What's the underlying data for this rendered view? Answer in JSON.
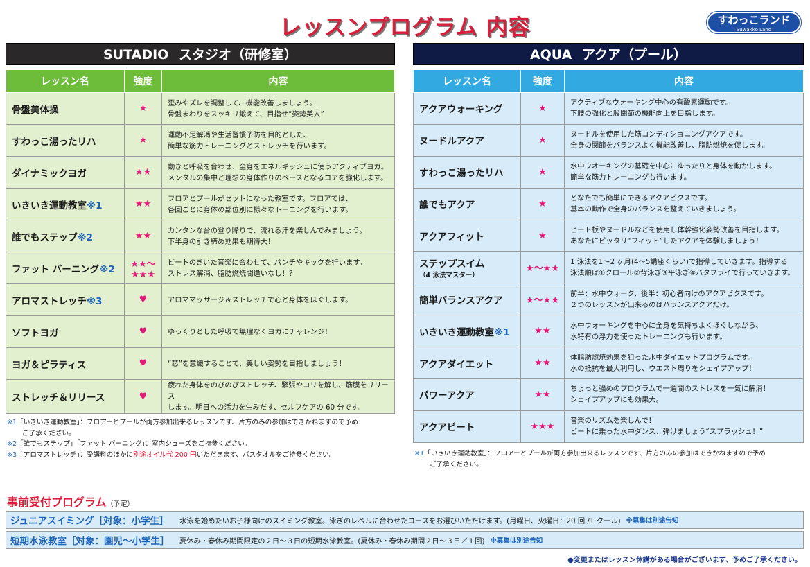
{
  "title": "レッスンプログラム 内容",
  "logo": {
    "main": "すわっこランド",
    "sub": "Suwakko Land"
  },
  "studio": {
    "heading_en": "SUTADIO",
    "heading_ja": "スタジオ（研修室）",
    "columns": [
      "レッスン名",
      "強度",
      "内容"
    ],
    "rows": [
      {
        "name": "骨盤美体操",
        "mark": "",
        "level": "★",
        "desc1": "歪みやズレを調整して、機能改善しましょう。",
        "desc2": "骨盤まわりをスッキリ鍛えて、目指せ“姿勢美人”"
      },
      {
        "name": "すわっこ湯ったリハ",
        "mark": "",
        "level": "★",
        "desc1": "運動不足解消や生活習慣予防を目的とした、",
        "desc2": "簡単な筋力トレーニングとストレッチを行います。"
      },
      {
        "name": "ダイナミックヨガ",
        "mark": "",
        "level": "★★",
        "desc1": "動きと呼吸を合わせ、全身をエネルギッシュに使うアクティブヨガ。",
        "desc2": "メンタルの集中と理想の身体作りのベースとなるコアを強化します。"
      },
      {
        "name": "いきいき運動教室",
        "mark": "※1",
        "level": "★★",
        "desc1": "フロアとプールがセットになった教室です。フロアでは、",
        "desc2": "各回ごとに身体の部位別に様々なトーニングを行います。"
      },
      {
        "name": "誰でもステップ",
        "mark": "※2",
        "level": "★★",
        "desc1": "カンタンな台の登り降りで、流れる汗を楽しんでみましょう。",
        "desc2": "下半身の引き締め効果も期待大！"
      },
      {
        "name": "ファット バーニング",
        "mark": "※2",
        "level": "★★～★★★",
        "desc1": "ビートのきいた音楽に合わせて、パンチやキックを行います。",
        "desc2": "ストレス解消、脂肪燃焼間違いなし！？"
      },
      {
        "name": "アロマストレッチ",
        "mark": "※3",
        "level": "♥",
        "desc1": "アロママッサージ＆ストレッチで心と身体をほぐします。",
        "desc2": ""
      },
      {
        "name": "ソフトヨガ",
        "mark": "",
        "level": "♥",
        "desc1": "ゆっくりとした呼吸で無理なくヨガにチャレンジ！",
        "desc2": ""
      },
      {
        "name": "ヨガ＆ピラティス",
        "mark": "",
        "level": "♥",
        "desc1": "“芯”を意識することで、美しい姿勢を目指しましょう！",
        "desc2": ""
      },
      {
        "name": "ストレッチ＆リリース",
        "mark": "",
        "level": "♥",
        "desc1": "疲れた身体をのびのびストレッチ、緊張やコリを解し、筋膜をリリース",
        "desc2": "します。明日への活力を生みだす、セルフケアの 60 分です。"
      }
    ],
    "notes": {
      "n1_mark": "※1",
      "n1_text": "「いきいき運動教室」：フロアーとプールが両方参加出来るレッスンです、片方のみの参加はできかねますので予め",
      "n1_cont": "ご了承ください。",
      "n2_mark": "※2",
      "n2_text": "「誰でもステップ」「ファット バーニング」：室内シューズをご持参ください。",
      "n3_mark": "※3",
      "n3_a": "「アロマストレッチ」：受講料のほかに",
      "n3_red": "別途オイル代 200 円",
      "n3_b": "いただきます、バスタオルをご持参ください。"
    }
  },
  "aqua": {
    "heading_en": "AQUA",
    "heading_ja": "アクア（プール）",
    "columns": [
      "レッスン名",
      "強度",
      "内容"
    ],
    "rows": [
      {
        "name": "アクアウォーキング",
        "sub": "",
        "mark": "",
        "level": "★",
        "desc1": "アクティブなウォーキング中心の有酸素運動です。",
        "desc2": "下肢の強化と股関節の機能向上を目指します。"
      },
      {
        "name": "ヌードルアクア",
        "sub": "",
        "mark": "",
        "level": "★",
        "desc1": "ヌードルを使用した筋コンディショニングアクアです。",
        "desc2": "全身の関節をバランスよく機能改善し、脂肪燃焼を促します。"
      },
      {
        "name": "すわっこ湯ったリハ",
        "sub": "",
        "mark": "",
        "level": "★",
        "desc1": "水中ウオーキングの基礎を中心にゆったりと身体を動かします。",
        "desc2": "簡単な筋力トレーニングも行います。"
      },
      {
        "name": "誰でもアクア",
        "sub": "",
        "mark": "",
        "level": "★",
        "desc1": "どなたでも簡単にできるアクアビクスです。",
        "desc2": "基本の動作で全身のバランスを整えていきましょう。"
      },
      {
        "name": "アクアフィット",
        "sub": "",
        "mark": "",
        "level": "★",
        "desc1": "ビート板やヌードルなどを使用し体幹強化姿勢改善を目指します。",
        "desc2": "あなたにピッタリ“フィット”したアクアを体験しましょう！"
      },
      {
        "name": "ステップスイム",
        "sub": "（4 泳法マスター）",
        "mark": "",
        "level": "★～★★",
        "desc1": "1 泳法を1～2 ヶ月(4～5講座くらい)で指導していきます。指導する",
        "desc2": "泳法順は①クロール②背泳ぎ③平泳ぎ④バタフライで行っていきます。"
      },
      {
        "name": "簡単バランスアクア",
        "sub": "",
        "mark": "",
        "level": "★～★★",
        "desc1": "前半：水中ウォーク、後半：初心者向けのアクアビクスです。",
        "desc2": "２つのレッスンが出来るのはバランスアクアだけ。"
      },
      {
        "name": "いきいき運動教室",
        "sub": "",
        "mark": "※1",
        "level": "★★",
        "desc1": "水中ウォーキングを中心に全身を気持ちよくほぐしながら、",
        "desc2": "水特有の浮力を使ったトレーニングも行います。"
      },
      {
        "name": "アクアダイエット",
        "sub": "",
        "mark": "",
        "level": "★★",
        "desc1": "体脂肪燃焼効果を狙った水中ダイエットプログラムです。",
        "desc2": "水の抵抗を最大利用し、ウエスト周りをシェイプアップ！"
      },
      {
        "name": "パワーアクア",
        "sub": "",
        "mark": "",
        "level": "★★",
        "desc1": "ちょっと強めのプログラムで一週間のストレスを一気に解消！",
        "desc2": "シェイプアップにも効果大。"
      },
      {
        "name": "アクアビート",
        "sub": "",
        "mark": "",
        "level": "★★★",
        "desc1": "音楽のリズムを楽しんで！",
        "desc2": "ビートに乗った水中ダンス、弾けましょう“スプラッシュ！”"
      }
    ],
    "notes": {
      "n1_mark": "※1",
      "n1_text": "「いきいき運動教室」：フロアーとプールが両方参加出来るレッスンです、片方のみの参加はできかねますので予め",
      "n1_cont": "ご了承ください。"
    }
  },
  "pre": {
    "title": "事前受付プログラム",
    "title_small": "（予定）",
    "rows": [
      {
        "name": "ジュニアスイミング［対象：小学生］",
        "desc": "水泳を始めたいお子様向けのスイミング教室。泳ぎのレベルに合わせたコースをお選びいただけます。(月曜日、火曜日：20 回 /1 クール)",
        "note": "※募集は別途告知"
      },
      {
        "name": "短期水泳教室［対象：園児～小学生］",
        "desc": "夏休み・春休み期間限定の２日～３日の短期水泳教室。(夏休み・春休み期間２日～３日／１回)",
        "note": "※募集は別途告知"
      }
    ]
  },
  "footer": "●変更またはレッスン休講がある場合がございます、予めご了承ください。"
}
